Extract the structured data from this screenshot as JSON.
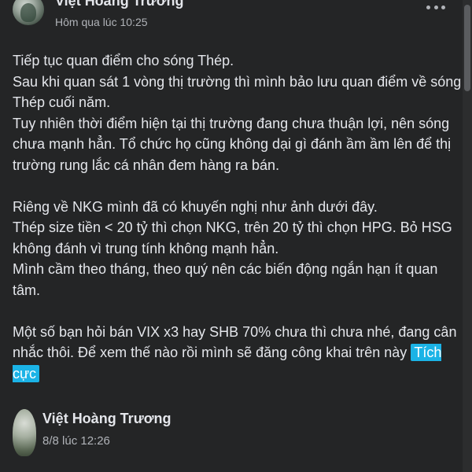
{
  "post": {
    "author": "Việt Hoàng Trương",
    "timestamp": "Hôm qua lúc 10:25",
    "more_icon": "more-dots-icon",
    "body": {
      "p1_l1": "Tiếp tục quan điểm cho sóng Thép.",
      "p1_l2": "Sau khi quan sát 1 vòng thị trường thì mình bảo lưu quan điểm về sóng Thép cuối năm.",
      "p1_l3": "Tuy nhiên thời điểm hiện tại thị trường đang chưa thuận lợi, nên sóng chưa mạnh hẳn. Tổ chức họ cũng không dại gì đánh ầm ầm lên để thị trường rung lắc cá nhân đem hàng ra bán.",
      "p2_l1": "Riêng về NKG mình đã có khuyến nghị như ảnh dưới đây.",
      "p2_l2": "Thép size tiền < 20 tỷ thì chọn NKG, trên 20 tỷ thì chọn HPG. Bỏ HSG không đánh vì trung tính không mạnh hẳn.",
      "p2_l3": "Mình cầm theo tháng, theo quý nên các biến động ngắn hạn ít quan tâm.",
      "p3_l1": "Một số bạn hỏi bán VIX x3 hay SHB 70% chưa thì chưa nhé, đang cân nhắc thôi. Để xem thế nào rồi mình sẽ đăng công khai trên này",
      "hashtag": "Tích cực"
    }
  },
  "comment": {
    "author": "Việt Hoàng Trương",
    "timestamp": "8/8 lúc 12:26"
  },
  "colors": {
    "background": "#242526",
    "text": "#e4e6eb",
    "secondary_text": "#b0b3b8",
    "hashtag_bg": "#1bb3e6"
  }
}
